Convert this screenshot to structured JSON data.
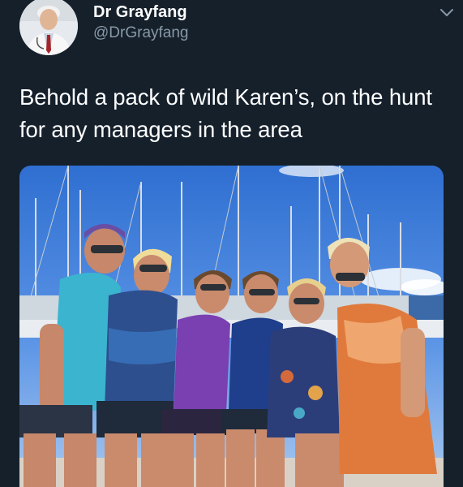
{
  "author": {
    "display_name": "Dr Grayfang",
    "handle": "@DrGrayfang",
    "avatar_icon": "avatar-photo"
  },
  "menu_icon": "chevron-down-icon",
  "tweet": {
    "text": "Behold a pack of wild Karen’s, on the hunt for any managers in the area"
  },
  "media": {
    "icon": "photo-group-of-women-at-marina"
  },
  "colors": {
    "background": "#15202b",
    "text": "#ffffff",
    "secondary_text": "#8899a6"
  }
}
